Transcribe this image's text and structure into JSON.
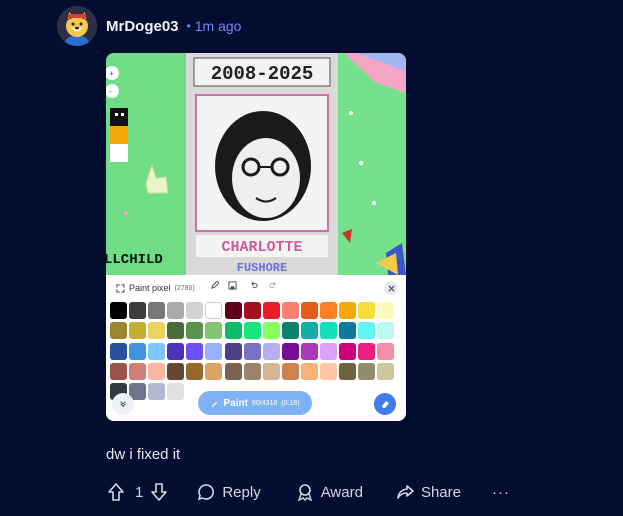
{
  "comment": {
    "username": "MrDoge03",
    "separator": "•",
    "time_ago": "1m ago",
    "body": "dw i fixed it"
  },
  "image": {
    "banner_top": "2008-2025",
    "banner_name_1": "CHARLOTTE",
    "banner_name_2": "FUSHORE",
    "side_text": "LLCHILD",
    "palette": {
      "title": "Paint pixel",
      "count": "(2786)",
      "paint_label": "Paint",
      "paint_count": "90/4318",
      "paint_timer": "(0:18)",
      "colors": [
        "#000000",
        "#3c3c3c",
        "#787878",
        "#aaaaaa",
        "#d2d2d2",
        "#ffffff",
        "#600018",
        "#a50e1e",
        "#ed1c24",
        "#fa8072",
        "#e45c1a",
        "#ff7f27",
        "#f6aa09",
        "#f9dd3b",
        "#fffabc",
        "#9c8431",
        "#c5ad31",
        "#e8d45f",
        "#4a6b3a",
        "#5a944a",
        "#84c573",
        "#0eb968",
        "#13e67b",
        "#87ff5e",
        "#0c816e",
        "#10aea6",
        "#13e1be",
        "#0f799f",
        "#60f7f2",
        "#bbfaf2",
        "#28509e",
        "#4093e4",
        "#7dc7ff",
        "#4d31b8",
        "#6b50f6",
        "#99b1fb",
        "#4a4284",
        "#7a71c4",
        "#b5aef1",
        "#780c99",
        "#aa38b9",
        "#e09ff9",
        "#cb007a",
        "#ec1f80",
        "#f38da9",
        "#9b5249",
        "#d18078",
        "#fab6a4",
        "#684634",
        "#95682a",
        "#dba463",
        "#7b6352",
        "#9c846b",
        "#d6b594",
        "#d18051",
        "#f8b277",
        "#ffc5a5",
        "#6d643f",
        "#948c6b",
        "#cdc59e",
        "#333941",
        "#6d758d",
        "#b3b9d1",
        "#e0e0e0"
      ]
    }
  },
  "actions": {
    "vote_count": "1",
    "reply": "Reply",
    "award": "Award",
    "share": "Share",
    "more": "···"
  }
}
